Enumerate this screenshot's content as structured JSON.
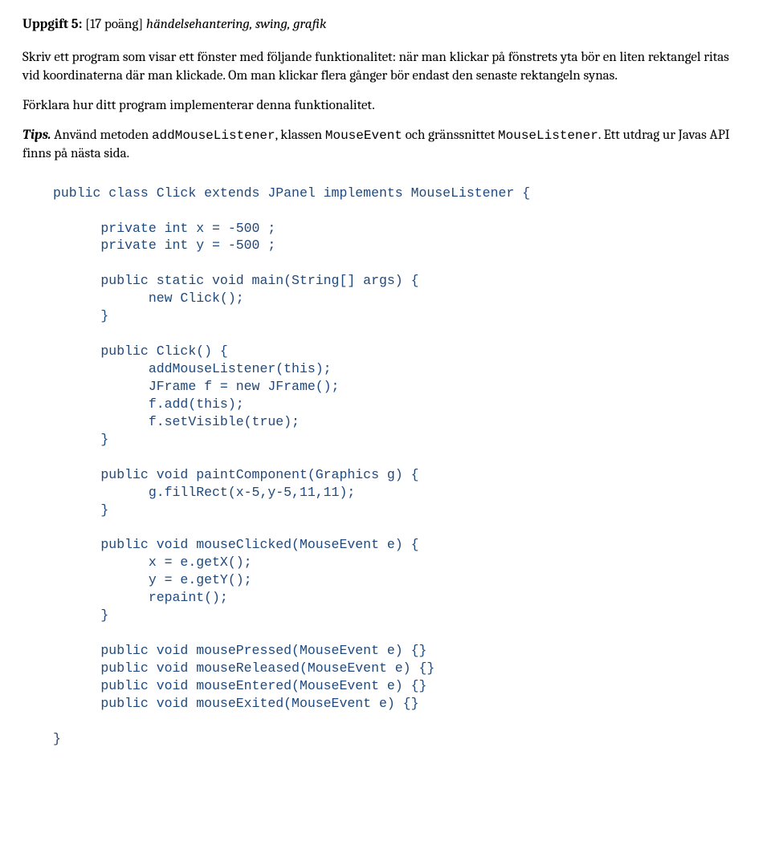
{
  "heading": {
    "label": "Uppgift 5:",
    "points": "[17 poäng]",
    "topics": "händelsehantering, swing, grafik"
  },
  "para1": "Skriv ett program som visar ett fönster med följande funktionalitet: när man klickar på fönstrets yta bör en liten rektangel ritas vid koordinaterna där man klickade. Om man klickar flera gånger bör endast den senaste rektangeln synas.",
  "para2": "Förklara hur ditt program implementerar denna funktionalitet.",
  "tips": {
    "label": "Tips.",
    "t1": " Använd metoden ",
    "c1": "addMouseListener",
    "t2": ", klassen ",
    "c2": "MouseEvent",
    "t3": " och gränssnittet ",
    "c3": "MouseListener",
    "t4": ". Ett utdrag ur Javas API finns på nästa sida."
  },
  "code": "public class Click extends JPanel implements MouseListener {\n\n      private int x = -500 ;\n      private int y = -500 ;\n\n      public static void main(String[] args) {\n            new Click();\n      }\n\n      public Click() {\n            addMouseListener(this);\n            JFrame f = new JFrame();\n            f.add(this);\n            f.setVisible(true);\n      }\n\n      public void paintComponent(Graphics g) {\n            g.fillRect(x-5,y-5,11,11);\n      }\n\n      public void mouseClicked(MouseEvent e) {\n            x = e.getX();\n            y = e.getY();\n            repaint();\n      }\n\n      public void mousePressed(MouseEvent e) {}\n      public void mouseReleased(MouseEvent e) {}\n      public void mouseEntered(MouseEvent e) {}\n      public void mouseExited(MouseEvent e) {}\n\n}"
}
